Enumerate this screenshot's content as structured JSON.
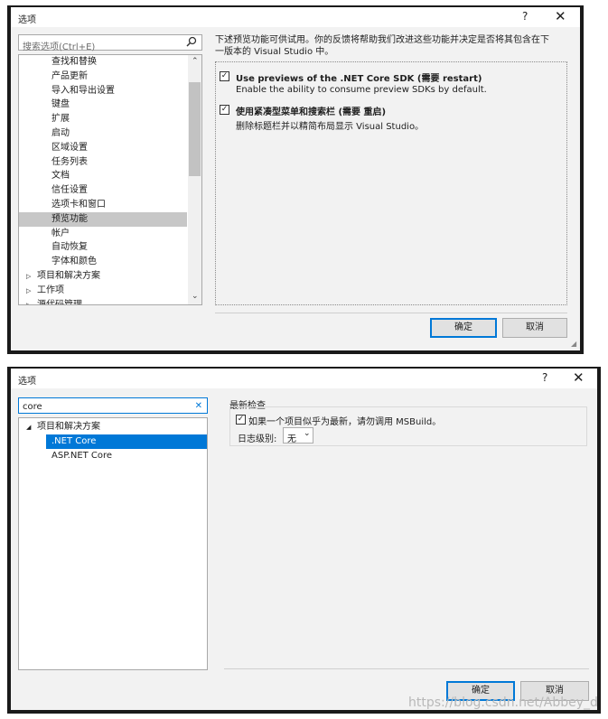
{
  "d1": {
    "title": "选项",
    "help": "?",
    "close": "✕",
    "search_placeholder": "搜索选项(Ctrl+E)",
    "search_icon": "magnifier-icon",
    "tree": [
      {
        "label": "查找和替换"
      },
      {
        "label": "产品更新"
      },
      {
        "label": "导入和导出设置"
      },
      {
        "label": "键盘"
      },
      {
        "label": "扩展"
      },
      {
        "label": "启动"
      },
      {
        "label": "区域设置"
      },
      {
        "label": "任务列表"
      },
      {
        "label": "文档"
      },
      {
        "label": "信任设置"
      },
      {
        "label": "选项卡和窗口"
      },
      {
        "label": "预览功能",
        "selected": true
      },
      {
        "label": "帐户"
      },
      {
        "label": "自动恢复"
      },
      {
        "label": "字体和颜色"
      },
      {
        "label": "项目和解决方案",
        "expander": "▷"
      },
      {
        "label": "工作项",
        "expander": "▷"
      },
      {
        "label": "源代码管理",
        "expander": "▷"
      }
    ],
    "description": "下述预览功能可供试用。你的反馈将帮助我们改进这些功能并决定是否将其包含在下",
    "description_line2": "一版本的 Visual Studio 中。",
    "options": [
      {
        "label": "Use previews of the .NET Core SDK (需要 restart)",
        "desc": "Enable the ability to consume preview SDKs by default.",
        "checked": true
      },
      {
        "label": "使用紧凑型菜单和搜索栏 (需要 重启)",
        "desc": "删除标题栏并以精简布局显示 Visual Studio。",
        "checked": true
      }
    ],
    "ok": "确定",
    "cancel": "取消"
  },
  "d2": {
    "title": "选项",
    "help": "?",
    "close": "✕",
    "search_value": "core",
    "search_clear": "✕",
    "tree": [
      {
        "label": "项目和解决方案",
        "expander": "◢"
      },
      {
        "label": ".NET Core",
        "selected": true
      },
      {
        "label": "ASP.NET Core"
      }
    ],
    "group_title": "最新检查",
    "check_label": "如果一个项目似乎为最新，请勿调用 MSBuild。",
    "log_label": "日志级别:",
    "log_value": "无",
    "ok": "确定",
    "cancel": "取消"
  },
  "watermark": "https://blog.csdn.net/Abbey_d",
  "colors": {
    "selection_blue": "#0078d7",
    "selection_gray": "#c7c7c7",
    "frame": "#1a1a1a"
  }
}
